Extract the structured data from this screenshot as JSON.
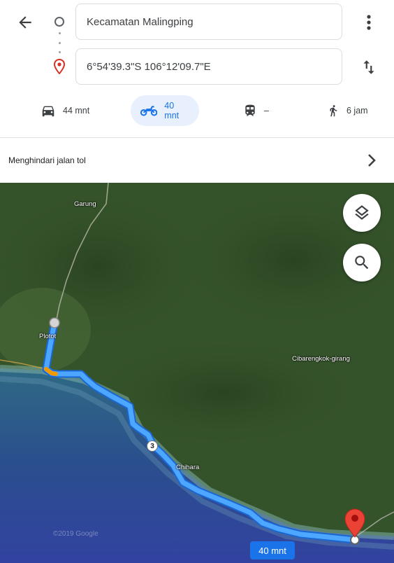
{
  "header": {
    "back_icon": "arrow-back-icon",
    "origin": {
      "icon": "origin-circle-icon",
      "value": "Kecamatan Malingping"
    },
    "destination": {
      "icon": "destination-pin-icon",
      "value": "6°54'39.3\"S 106°12'09.7\"E"
    },
    "more_icon": "more-vert-icon",
    "swap_icon": "swap-vert-icon"
  },
  "modes": [
    {
      "id": "car",
      "icon": "car-icon",
      "label": "44 mnt",
      "active": false
    },
    {
      "id": "motorcycle",
      "icon": "motorcycle-icon",
      "label": "40 mnt",
      "active": true
    },
    {
      "id": "transit",
      "icon": "train-icon",
      "label": "–",
      "active": false
    },
    {
      "id": "walk",
      "icon": "walking-icon",
      "label": "6 jam",
      "active": false
    }
  ],
  "route_options": {
    "label": "Menghindari jalan tol",
    "icon": "chevron-right-icon"
  },
  "map": {
    "places": [
      "Garung",
      "Plotot",
      "Cibarengkok-girang",
      "Chihara"
    ],
    "route_number": "3",
    "eta_label": "40 mnt",
    "copyright": "©2019 Google",
    "layers_icon": "layers-icon",
    "search_icon": "search-icon",
    "route_color": "#4da6ff",
    "pin_color": "#ea4335"
  }
}
